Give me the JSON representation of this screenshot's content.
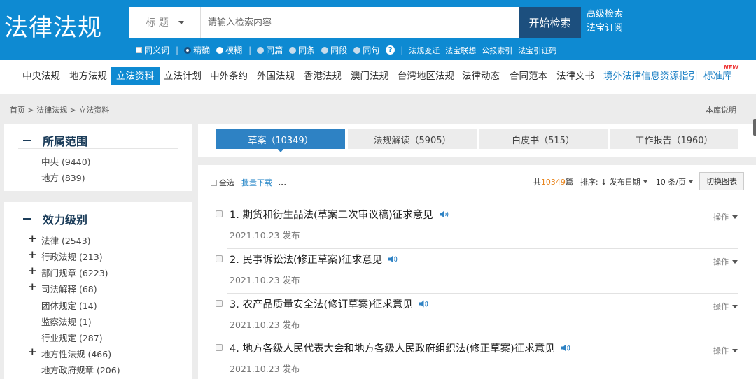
{
  "header": {
    "logo": "法律法规",
    "search_type": "标 题",
    "search_placeholder": "请输入检索内容",
    "search_button": "开始检索",
    "advanced_search": "高级检索",
    "subscribe": "法宝订阅",
    "options": {
      "synonym": "同义词",
      "precise": "精确",
      "fuzzy": "模糊",
      "same_article": "同篇",
      "same_clause": "同条",
      "same_paragraph": "同段",
      "same_sentence": "同句",
      "links": [
        "法规变迁",
        "法宝联想",
        "公报索引",
        "法宝引证码"
      ]
    }
  },
  "nav": {
    "items": [
      "中央法规",
      "地方法规",
      "立法资料",
      "立法计划",
      "中外条约",
      "外国法规",
      "香港法规",
      "澳门法规",
      "台湾地区法规",
      "法律动态",
      "合同范本",
      "法律文书",
      "境外法律信息资源指引",
      "标准库"
    ],
    "active_index": 2,
    "new_badge": "NEW"
  },
  "breadcrumb": "首页 > 法律法规 > 立法资料",
  "library_note": "本库说明",
  "sidebar": {
    "scope": {
      "title": "所属范围",
      "items": [
        "中央 (9440)",
        "地方 (839)"
      ]
    },
    "level": {
      "title": "效力级别",
      "items": [
        {
          "label": "法律 (2543)",
          "expandable": true
        },
        {
          "label": "行政法规 (213)",
          "expandable": true
        },
        {
          "label": "部门规章 (6223)",
          "expandable": true
        },
        {
          "label": "司法解释 (68)",
          "expandable": true
        },
        {
          "label": "团体规定 (14)",
          "expandable": false
        },
        {
          "label": "监察法规 (1)",
          "expandable": false
        },
        {
          "label": "行业规定 (287)",
          "expandable": false
        },
        {
          "label": "地方性法规 (466)",
          "expandable": true
        },
        {
          "label": "地方政府规章 (206)",
          "expandable": false
        }
      ]
    }
  },
  "tabs": [
    "草案（10349）",
    "法规解读（5905）",
    "白皮书（515）",
    "工作报告（1960）"
  ],
  "toolbar": {
    "select_all": "全选",
    "batch_download": "批量下载",
    "more": "...",
    "total_prefix": "共",
    "total_count": "10349",
    "total_suffix": "篇",
    "sort_label": "排序: ↓ 发布日期",
    "per_page": "10 条/页",
    "switch_chart": "切换图表"
  },
  "results": [
    {
      "title": "1. 期货和衍生品法(草案二次审议稿)征求意见",
      "date": "2021.10.23 发布",
      "op": "操作"
    },
    {
      "title": "2. 民事诉讼法(修正草案)征求意见",
      "date": "2021.10.23 发布",
      "op": "操作"
    },
    {
      "title": "3. 农产品质量安全法(修订草案)征求意见",
      "date": "2021.10.23 发布",
      "op": "操作"
    },
    {
      "title": "4. 地方各级人民代表大会和地方各级人民政府组织法(修正草案)征求意见",
      "date": "2021.10.23 发布",
      "op": "操作"
    }
  ]
}
